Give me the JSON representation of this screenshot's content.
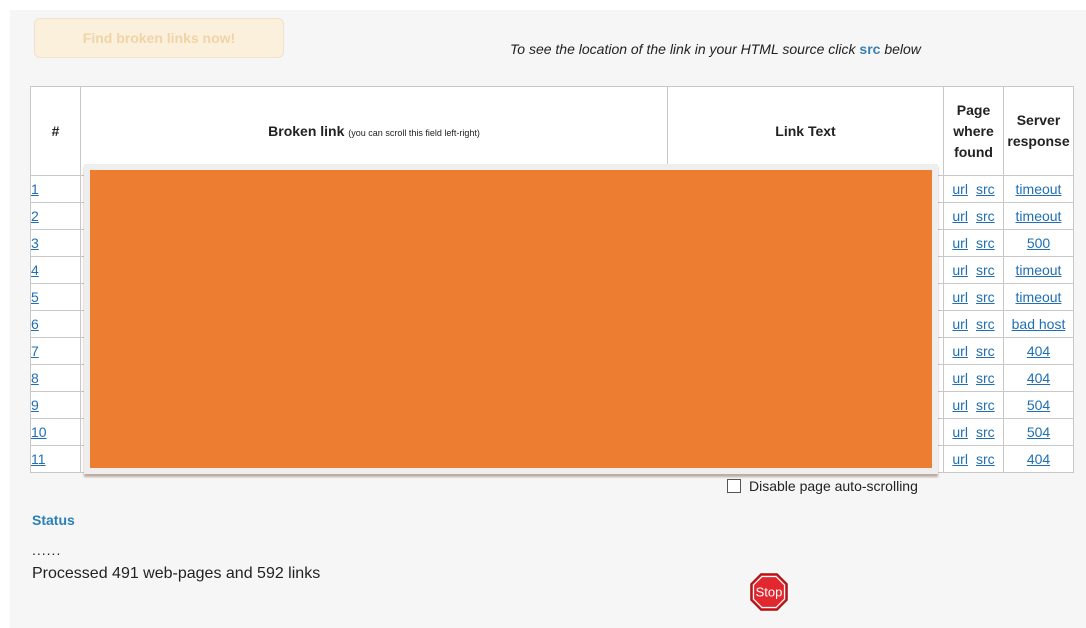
{
  "find_button": {
    "label": "Find broken links now!"
  },
  "hint": {
    "before": "To see the location of the link in your HTML source click ",
    "src": "src",
    "after": " below"
  },
  "table": {
    "headers": {
      "num": "#",
      "broken_link": "Broken link",
      "broken_link_note": "(you can scroll this field left-right)",
      "link_text": "Link Text",
      "page_where_found_1": "Page",
      "page_where_found_2": "where",
      "page_where_found_3": "found",
      "server_response_1": "Server",
      "server_response_2": "response"
    },
    "url_label": "url",
    "src_label": "src",
    "rows": [
      {
        "num": "1",
        "response": "timeout"
      },
      {
        "num": "2",
        "response": "timeout"
      },
      {
        "num": "3",
        "response": "500"
      },
      {
        "num": "4",
        "response": "timeout"
      },
      {
        "num": "5",
        "response": "timeout"
      },
      {
        "num": "6",
        "response": "bad host"
      },
      {
        "num": "7",
        "response": "404"
      },
      {
        "num": "8",
        "response": "404"
      },
      {
        "num": "9",
        "response": "504"
      },
      {
        "num": "10",
        "response": "504"
      },
      {
        "num": "11",
        "response": "404"
      }
    ]
  },
  "overlay_color": "#ec7d31",
  "auto_scroll": {
    "label": "Disable page auto-scrolling",
    "checked": false
  },
  "status": {
    "title": "Status",
    "dots": "......",
    "message": "Processed 491 web-pages and 592 links"
  },
  "stop_button": {
    "label": "Stop",
    "color": "#e0282e"
  }
}
